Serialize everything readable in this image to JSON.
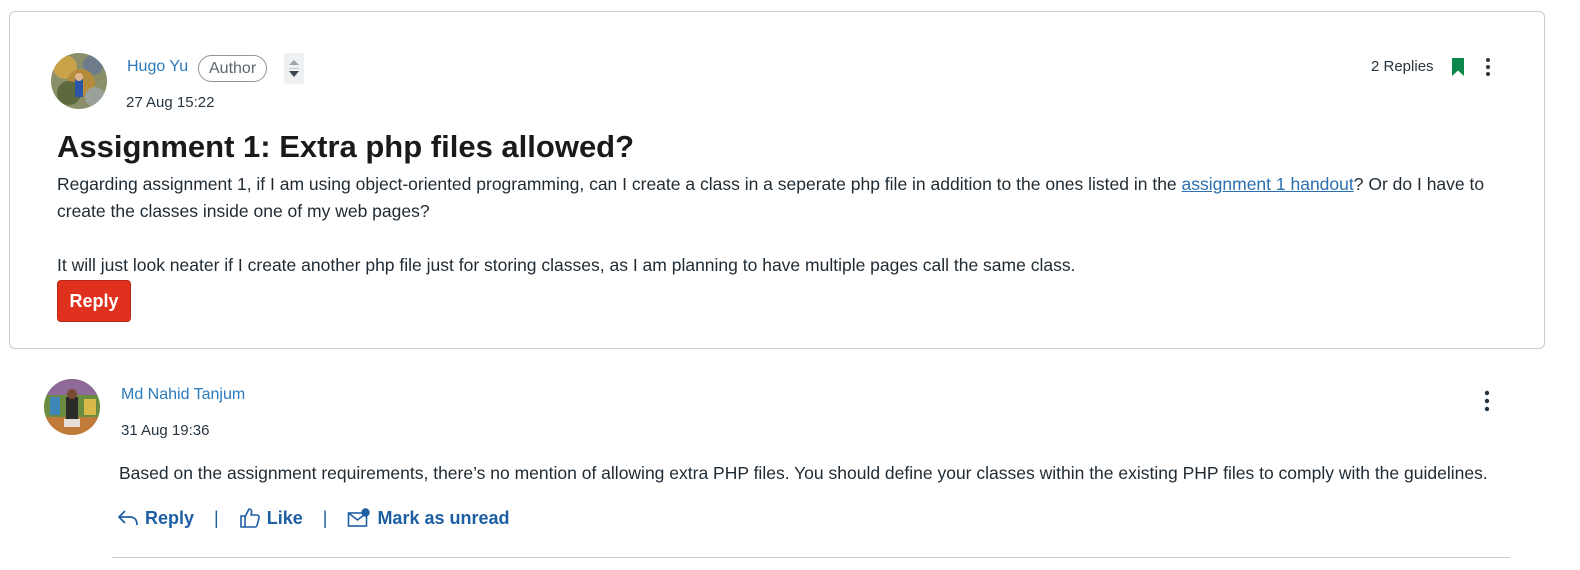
{
  "topic": {
    "author": {
      "name": "Hugo Yu",
      "badge": "Author",
      "timestamp": "27 Aug 15:22"
    },
    "replies_label": "2 Replies",
    "title": "Assignment 1: Extra php files allowed?",
    "body": {
      "p1_before_link": "Regarding assignment 1, if I am using object-oriented programming, can I create a class in a seperate php file in addition to the ones listed in the ",
      "link_text": "assignment 1 handout",
      "p1_after_link": "? Or do I have to create the classes inside one of my web pages?",
      "p2": "It will just look neater if I create another php file just for storing classes, as I am planning to have multiple pages call the same class."
    },
    "reply_button": "Reply",
    "icons": {
      "sort": "sort-arrows-icon",
      "bookmark": "bookmark-icon",
      "menu": "kebab-menu-icon"
    },
    "colors": {
      "bookmark": "#0b874b",
      "reply_button": "#e0301e",
      "link": "#2b6fb0"
    }
  },
  "reply": {
    "author": {
      "name": "Md Nahid Tanjum",
      "timestamp": "31 Aug 19:36"
    },
    "text": "Based on the assignment requirements, there’s no mention of allowing extra PHP files. You should define your classes within the existing PHP files to comply with the guidelines.",
    "actions": {
      "reply": "Reply",
      "separator": "|",
      "like": "Like",
      "mark_unread": "Mark as unread"
    },
    "icons": {
      "reply": "reply-arrow-icon",
      "like": "thumbs-up-icon",
      "mark_unread": "mail-unread-icon",
      "menu": "kebab-menu-icon"
    },
    "colors": {
      "action": "#1e5fa3"
    }
  }
}
